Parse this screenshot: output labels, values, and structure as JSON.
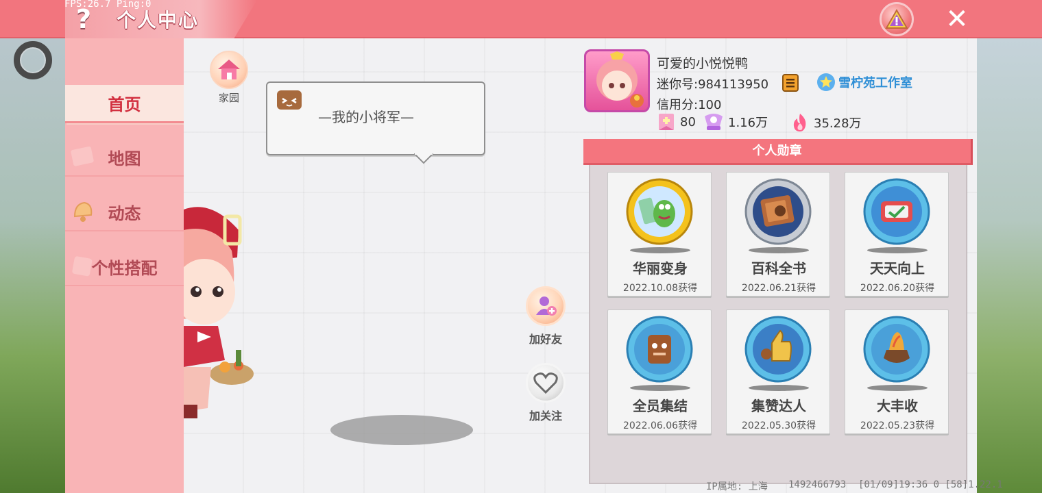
{
  "overlay": {
    "fps_text": "FPS:26.7  Ping:0"
  },
  "header": {
    "help_glyph": "?",
    "title": "个人中心",
    "close_glyph": "✕"
  },
  "sidebar": {
    "items": [
      {
        "label": "首页",
        "active": true
      },
      {
        "label": "地图",
        "active": false
      },
      {
        "label": "动态",
        "active": false
      },
      {
        "label": "个性搭配",
        "active": false
      }
    ]
  },
  "home": {
    "label": "家园"
  },
  "speech": {
    "text": "—我的小将军—"
  },
  "actions": {
    "add_friend_label": "加好友",
    "follow_label": "加关注"
  },
  "profile": {
    "nickname": "可爱的小悦悦鸭",
    "mini_id": "迷你号:984113950",
    "credit": "信用分:100",
    "studio": "雪柠苑工作室",
    "stats": [
      {
        "icon": "level-icon",
        "value": "80"
      },
      {
        "icon": "fans-icon",
        "value": "1.16万"
      },
      {
        "icon": "heat-icon",
        "value": "35.28万"
      }
    ]
  },
  "badges": {
    "title": "个人勋章",
    "items": [
      {
        "name": "华丽变身",
        "date": "2022.10.08获得",
        "frame": "gold"
      },
      {
        "name": "百科全书",
        "date": "2022.06.21获得",
        "frame": "silver"
      },
      {
        "name": "天天向上",
        "date": "2022.06.20获得",
        "frame": "blue"
      },
      {
        "name": "全员集结",
        "date": "2022.06.06获得",
        "frame": "blue"
      },
      {
        "name": "集赞达人",
        "date": "2022.05.30获得",
        "frame": "blue"
      },
      {
        "name": "大丰收",
        "date": "2022.05.23获得",
        "frame": "blue"
      }
    ]
  },
  "footer": {
    "ip_location": "IP属地: 上海",
    "uid": "1492466793",
    "build": "[01/09]19:36 0  [58]1.22.1"
  },
  "colors": {
    "header_bg": "#f2757e",
    "sidebar_bg": "#f9b4b6",
    "studio_blue": "#2f8fd6"
  }
}
